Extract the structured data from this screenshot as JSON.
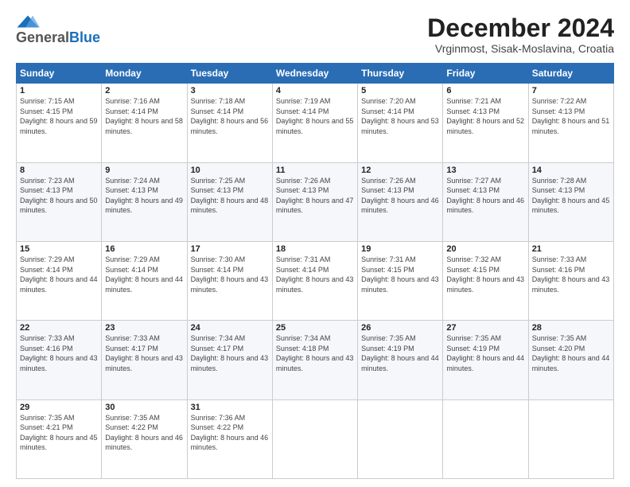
{
  "header": {
    "logo": {
      "general": "General",
      "blue": "Blue"
    },
    "title": "December 2024",
    "location": "Vrginmost, Sisak-Moslavina, Croatia"
  },
  "weekdays": [
    "Sunday",
    "Monday",
    "Tuesday",
    "Wednesday",
    "Thursday",
    "Friday",
    "Saturday"
  ],
  "weeks": [
    [
      {
        "day": "1",
        "sunrise": "Sunrise: 7:15 AM",
        "sunset": "Sunset: 4:15 PM",
        "daylight": "Daylight: 8 hours and 59 minutes."
      },
      {
        "day": "2",
        "sunrise": "Sunrise: 7:16 AM",
        "sunset": "Sunset: 4:14 PM",
        "daylight": "Daylight: 8 hours and 58 minutes."
      },
      {
        "day": "3",
        "sunrise": "Sunrise: 7:18 AM",
        "sunset": "Sunset: 4:14 PM",
        "daylight": "Daylight: 8 hours and 56 minutes."
      },
      {
        "day": "4",
        "sunrise": "Sunrise: 7:19 AM",
        "sunset": "Sunset: 4:14 PM",
        "daylight": "Daylight: 8 hours and 55 minutes."
      },
      {
        "day": "5",
        "sunrise": "Sunrise: 7:20 AM",
        "sunset": "Sunset: 4:14 PM",
        "daylight": "Daylight: 8 hours and 53 minutes."
      },
      {
        "day": "6",
        "sunrise": "Sunrise: 7:21 AM",
        "sunset": "Sunset: 4:13 PM",
        "daylight": "Daylight: 8 hours and 52 minutes."
      },
      {
        "day": "7",
        "sunrise": "Sunrise: 7:22 AM",
        "sunset": "Sunset: 4:13 PM",
        "daylight": "Daylight: 8 hours and 51 minutes."
      }
    ],
    [
      {
        "day": "8",
        "sunrise": "Sunrise: 7:23 AM",
        "sunset": "Sunset: 4:13 PM",
        "daylight": "Daylight: 8 hours and 50 minutes."
      },
      {
        "day": "9",
        "sunrise": "Sunrise: 7:24 AM",
        "sunset": "Sunset: 4:13 PM",
        "daylight": "Daylight: 8 hours and 49 minutes."
      },
      {
        "day": "10",
        "sunrise": "Sunrise: 7:25 AM",
        "sunset": "Sunset: 4:13 PM",
        "daylight": "Daylight: 8 hours and 48 minutes."
      },
      {
        "day": "11",
        "sunrise": "Sunrise: 7:26 AM",
        "sunset": "Sunset: 4:13 PM",
        "daylight": "Daylight: 8 hours and 47 minutes."
      },
      {
        "day": "12",
        "sunrise": "Sunrise: 7:26 AM",
        "sunset": "Sunset: 4:13 PM",
        "daylight": "Daylight: 8 hours and 46 minutes."
      },
      {
        "day": "13",
        "sunrise": "Sunrise: 7:27 AM",
        "sunset": "Sunset: 4:13 PM",
        "daylight": "Daylight: 8 hours and 46 minutes."
      },
      {
        "day": "14",
        "sunrise": "Sunrise: 7:28 AM",
        "sunset": "Sunset: 4:13 PM",
        "daylight": "Daylight: 8 hours and 45 minutes."
      }
    ],
    [
      {
        "day": "15",
        "sunrise": "Sunrise: 7:29 AM",
        "sunset": "Sunset: 4:14 PM",
        "daylight": "Daylight: 8 hours and 44 minutes."
      },
      {
        "day": "16",
        "sunrise": "Sunrise: 7:29 AM",
        "sunset": "Sunset: 4:14 PM",
        "daylight": "Daylight: 8 hours and 44 minutes."
      },
      {
        "day": "17",
        "sunrise": "Sunrise: 7:30 AM",
        "sunset": "Sunset: 4:14 PM",
        "daylight": "Daylight: 8 hours and 43 minutes."
      },
      {
        "day": "18",
        "sunrise": "Sunrise: 7:31 AM",
        "sunset": "Sunset: 4:14 PM",
        "daylight": "Daylight: 8 hours and 43 minutes."
      },
      {
        "day": "19",
        "sunrise": "Sunrise: 7:31 AM",
        "sunset": "Sunset: 4:15 PM",
        "daylight": "Daylight: 8 hours and 43 minutes."
      },
      {
        "day": "20",
        "sunrise": "Sunrise: 7:32 AM",
        "sunset": "Sunset: 4:15 PM",
        "daylight": "Daylight: 8 hours and 43 minutes."
      },
      {
        "day": "21",
        "sunrise": "Sunrise: 7:33 AM",
        "sunset": "Sunset: 4:16 PM",
        "daylight": "Daylight: 8 hours and 43 minutes."
      }
    ],
    [
      {
        "day": "22",
        "sunrise": "Sunrise: 7:33 AM",
        "sunset": "Sunset: 4:16 PM",
        "daylight": "Daylight: 8 hours and 43 minutes."
      },
      {
        "day": "23",
        "sunrise": "Sunrise: 7:33 AM",
        "sunset": "Sunset: 4:17 PM",
        "daylight": "Daylight: 8 hours and 43 minutes."
      },
      {
        "day": "24",
        "sunrise": "Sunrise: 7:34 AM",
        "sunset": "Sunset: 4:17 PM",
        "daylight": "Daylight: 8 hours and 43 minutes."
      },
      {
        "day": "25",
        "sunrise": "Sunrise: 7:34 AM",
        "sunset": "Sunset: 4:18 PM",
        "daylight": "Daylight: 8 hours and 43 minutes."
      },
      {
        "day": "26",
        "sunrise": "Sunrise: 7:35 AM",
        "sunset": "Sunset: 4:19 PM",
        "daylight": "Daylight: 8 hours and 44 minutes."
      },
      {
        "day": "27",
        "sunrise": "Sunrise: 7:35 AM",
        "sunset": "Sunset: 4:19 PM",
        "daylight": "Daylight: 8 hours and 44 minutes."
      },
      {
        "day": "28",
        "sunrise": "Sunrise: 7:35 AM",
        "sunset": "Sunset: 4:20 PM",
        "daylight": "Daylight: 8 hours and 44 minutes."
      }
    ],
    [
      {
        "day": "29",
        "sunrise": "Sunrise: 7:35 AM",
        "sunset": "Sunset: 4:21 PM",
        "daylight": "Daylight: 8 hours and 45 minutes."
      },
      {
        "day": "30",
        "sunrise": "Sunrise: 7:35 AM",
        "sunset": "Sunset: 4:22 PM",
        "daylight": "Daylight: 8 hours and 46 minutes."
      },
      {
        "day": "31",
        "sunrise": "Sunrise: 7:36 AM",
        "sunset": "Sunset: 4:22 PM",
        "daylight": "Daylight: 8 hours and 46 minutes."
      },
      null,
      null,
      null,
      null
    ]
  ]
}
